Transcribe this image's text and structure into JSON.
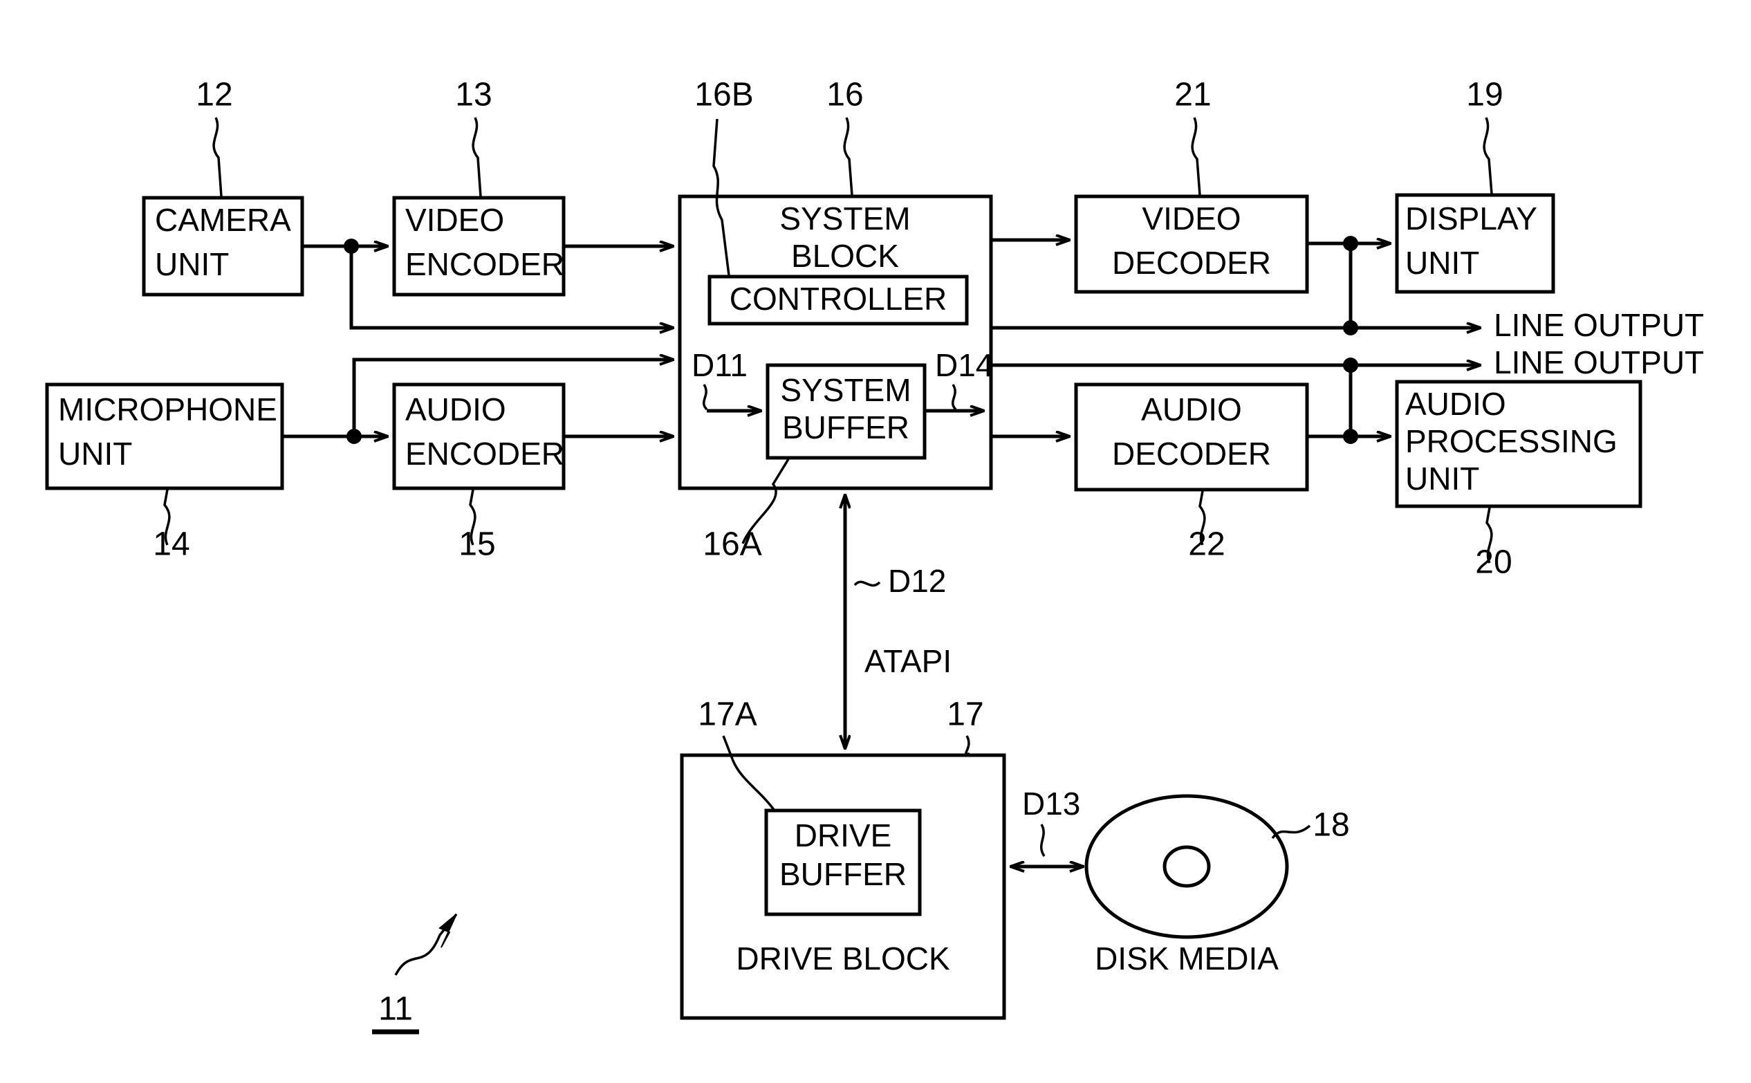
{
  "figure": {
    "reference_numeral": "11",
    "underline": true
  },
  "blocks": {
    "camera_unit": {
      "line1": "CAMERA",
      "line2": "UNIT",
      "ref": "12"
    },
    "video_encoder": {
      "line1": "VIDEO",
      "line2": "ENCODER",
      "ref": "13"
    },
    "microphone_unit": {
      "line1": "MICROPHONE",
      "line2": "UNIT",
      "ref": "14"
    },
    "audio_encoder": {
      "line1": "AUDIO",
      "line2": "ENCODER",
      "ref": "15"
    },
    "system_block": {
      "line1": "SYSTEM",
      "line2": "BLOCK",
      "ref": "16"
    },
    "controller": {
      "label": "CONTROLLER",
      "ref": "16B"
    },
    "system_buffer": {
      "line1": "SYSTEM",
      "line2": "BUFFER",
      "ref": "16A"
    },
    "video_decoder": {
      "line1": "VIDEO",
      "line2": "DECODER",
      "ref": "21"
    },
    "display_unit": {
      "line1": "DISPLAY",
      "line2": "UNIT",
      "ref": "19"
    },
    "audio_decoder": {
      "line1": "AUDIO",
      "line2": "DECODER",
      "ref": "22"
    },
    "audio_processing_unit": {
      "line1": "AUDIO",
      "line2": "PROCESSING",
      "line3": "UNIT",
      "ref": "20"
    },
    "drive_block": {
      "label": "DRIVE BLOCK",
      "ref": "17"
    },
    "drive_buffer": {
      "line1": "DRIVE",
      "line2": "BUFFER",
      "ref": "17A"
    },
    "disk_media": {
      "label": "DISK MEDIA",
      "ref": "18"
    }
  },
  "signals": {
    "d11": "D11",
    "d12": "D12",
    "d13": "D13",
    "d14": "D14",
    "atapi": "ATAPI"
  },
  "outputs": {
    "line_output_1": "LINE OUTPUT",
    "line_output_2": "LINE OUTPUT"
  },
  "colors": {
    "stroke": "#000000",
    "background": "#ffffff"
  }
}
